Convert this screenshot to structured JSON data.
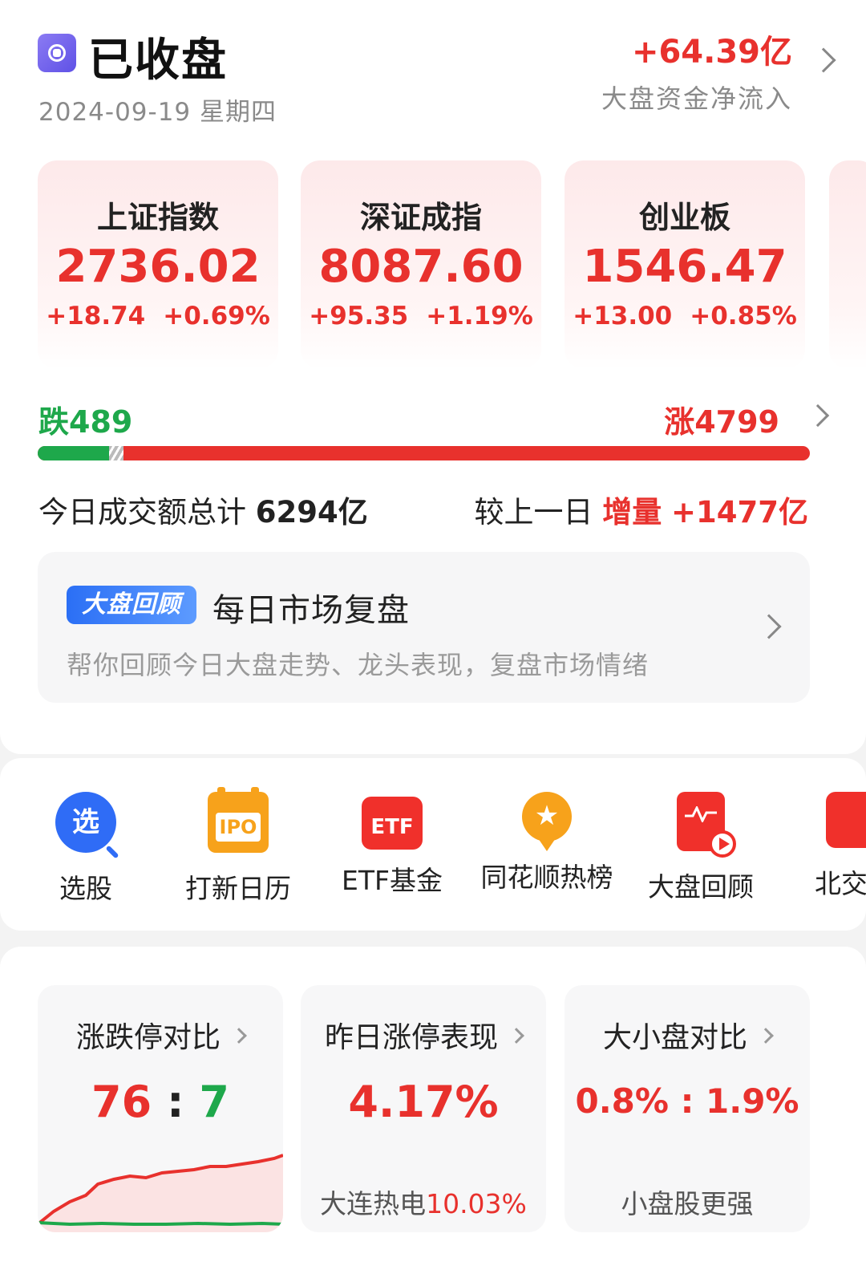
{
  "header": {
    "status": "已收盘",
    "date": "2024-09-19 星期四",
    "net_flow_value": "+64.39亿",
    "net_flow_label": "大盘资金净流入"
  },
  "indices": [
    {
      "name": "上证指数",
      "value": "2736.02",
      "change": "+18.74",
      "change_pct": "+0.69%"
    },
    {
      "name": "深证成指",
      "value": "8087.60",
      "change": "+95.35",
      "change_pct": "+1.19%"
    },
    {
      "name": "创业板",
      "value": "1546.47",
      "change": "+13.00",
      "change_pct": "+0.85%"
    }
  ],
  "breadth": {
    "fall_label": "跌489",
    "rise_label": "涨4799",
    "fall": 489,
    "rise": 4799
  },
  "turnover": {
    "label": "今日成交额总计",
    "value": "6294亿",
    "compare_label": "较上一日",
    "compare_word": "增量",
    "compare_value": "+1477亿"
  },
  "review": {
    "badge": "大盘回顾",
    "title": "每日市场复盘",
    "desc": "帮你回顾今日大盘走势、龙头表现，复盘市场情绪"
  },
  "tools": [
    {
      "label": "选股",
      "icon": "select-stock-icon",
      "glyph": "选"
    },
    {
      "label": "打新日历",
      "icon": "ipo-calendar-icon",
      "glyph": "IPO"
    },
    {
      "label": "ETF基金",
      "icon": "etf-icon",
      "glyph": "ETF"
    },
    {
      "label": "同花顺热榜",
      "icon": "hot-list-icon",
      "glyph": "★"
    },
    {
      "label": "大盘回顾",
      "icon": "market-review-icon",
      "glyph": ""
    },
    {
      "label": "北交",
      "icon": "beijing-exchange-icon",
      "glyph": ""
    }
  ],
  "stats": [
    {
      "title": "涨跌停对比",
      "left": "76",
      "sep": ":",
      "right": "7"
    },
    {
      "title": "昨日涨停表现",
      "value": "4.17%",
      "sub_name": "大连热电",
      "sub_value": "10.03%"
    },
    {
      "title": "大小盘对比",
      "value": "0.8% : 1.9%",
      "sub": "小盘股更强"
    }
  ],
  "colors": {
    "up": "#e8312d",
    "down": "#1ea84b",
    "accent": "#2f6cf6"
  }
}
